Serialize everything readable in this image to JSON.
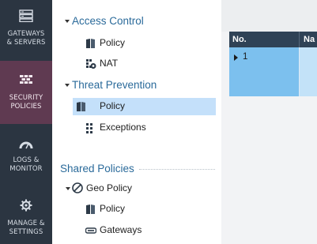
{
  "rail": {
    "items": [
      {
        "label_1": "GATEWAYS",
        "label_2": "& SERVERS",
        "icon": "gateways-servers-icon"
      },
      {
        "label_1": "SECURITY",
        "label_2": "POLICIES",
        "icon": "security-policies-icon",
        "active": true
      },
      {
        "label_1": "LOGS &",
        "label_2": "MONITOR",
        "icon": "logs-monitor-icon"
      },
      {
        "label_1": "MANAGE &",
        "label_2": "SETTINGS",
        "icon": "gear-icon"
      }
    ]
  },
  "tree": {
    "access_control": {
      "title": "Access Control",
      "items": [
        {
          "label": "Policy",
          "icon": "policy-book-icon"
        },
        {
          "label": "NAT",
          "icon": "nat-icon"
        }
      ]
    },
    "threat_prevention": {
      "title": "Threat Prevention",
      "items": [
        {
          "label": "Policy",
          "icon": "policy-book-icon",
          "selected": true
        },
        {
          "label": "Exceptions",
          "icon": "exceptions-icon"
        }
      ]
    },
    "shared_policies": {
      "title": "Shared Policies",
      "items": [
        {
          "label": "Geo Policy",
          "icon": "geo-policy-icon"
        },
        {
          "label": "Policy",
          "icon": "policy-book-icon"
        },
        {
          "label": "Gateways",
          "icon": "gateways-icon"
        }
      ]
    }
  },
  "grid": {
    "columns": [
      "No.",
      "Na"
    ],
    "rows": [
      {
        "number": "1"
      }
    ]
  },
  "colors": {
    "rail_bg": "#2b3541",
    "rail_active": "#5f3a51",
    "section_title": "#2a6a9a",
    "selected_node": "#c4e0fa",
    "grid_header": "#2f4256",
    "selected_row": "#7cc0ee"
  }
}
